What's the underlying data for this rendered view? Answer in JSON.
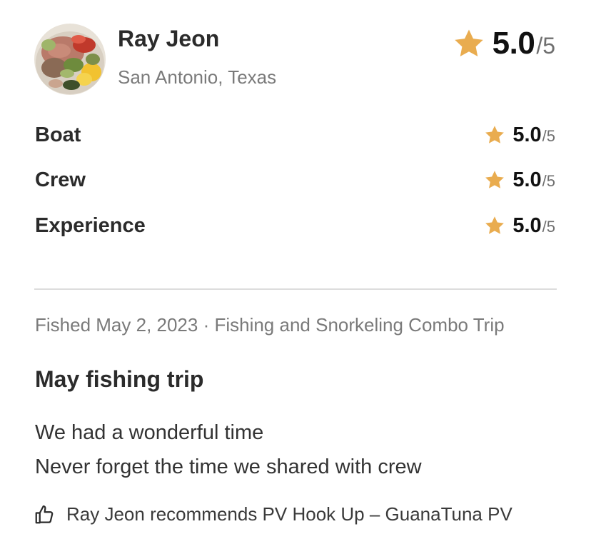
{
  "reviewer": {
    "name": "Ray Jeon",
    "location": "San Antonio, Texas",
    "avatar_icon": "food-platter-photo"
  },
  "overall_rating": {
    "score": "5.0",
    "out_of": "/5",
    "icon": "star-icon",
    "value": 5.0,
    "max": 5
  },
  "category_ratings": [
    {
      "label": "Boat",
      "score": "5.0",
      "out_of": "/5"
    },
    {
      "label": "Crew",
      "score": "5.0",
      "out_of": "/5"
    },
    {
      "label": "Experience",
      "score": "5.0",
      "out_of": "/5"
    }
  ],
  "trip_meta": "Fished May 2, 2023 · Fishing and Snorkeling Combo Trip",
  "review": {
    "title": "May fishing trip",
    "body_lines": [
      "We had a wonderful time",
      "Never forget the time we shared with crew"
    ]
  },
  "recommendation": {
    "icon": "thumbs-up-icon",
    "text": "Ray Jeon recommends PV Hook Up – GuanaTuna PV"
  },
  "colors": {
    "star": "#E9AC4F",
    "primary_text": "#2B2B2B",
    "secondary_text": "#7A7A7A",
    "divider": "#DCDCDC"
  }
}
